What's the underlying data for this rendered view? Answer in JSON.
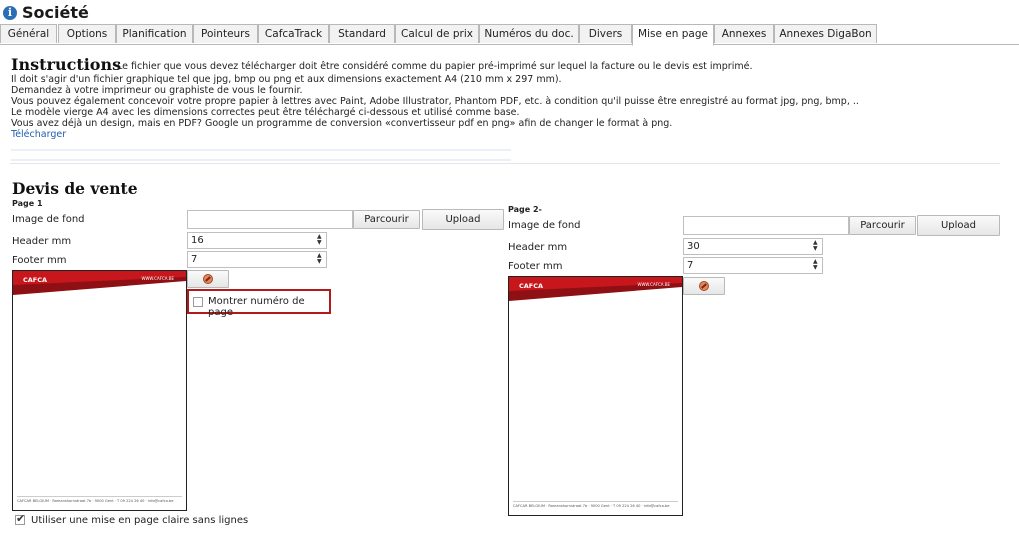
{
  "header": {
    "title": "Société",
    "info_icon": "i"
  },
  "tabs": [
    {
      "label": "Général",
      "active": false
    },
    {
      "label": "Options",
      "active": false
    },
    {
      "label": "Planification",
      "active": false
    },
    {
      "label": "Pointeurs",
      "active": false
    },
    {
      "label": "CafcaTrack",
      "active": false
    },
    {
      "label": "Standard",
      "active": false
    },
    {
      "label": "Calcul de prix",
      "active": false
    },
    {
      "label": "Numéros du doc.",
      "active": false
    },
    {
      "label": "Divers",
      "active": false
    },
    {
      "label": "Mise en page",
      "active": true
    },
    {
      "label": "Annexes",
      "active": false
    },
    {
      "label": "Annexes DigaBon",
      "active": false
    }
  ],
  "instructions": {
    "title": "Instructions",
    "lead": "Le fichier que vous devez télécharger doit être considéré comme du papier pré-imprimé sur lequel la facture ou le devis est imprimé.",
    "lines": [
      "Il doit s'agir d'un fichier graphique tel que jpg, bmp ou png et aux dimensions exactement A4 (210 mm x 297 mm).",
      "Demandez à votre imprimeur ou graphiste de vous le fournir.",
      "Vous pouvez également concevoir votre propre papier à lettres avec Paint, Adobe Illustrator, Phantom PDF, etc. à condition qu'il puisse être enregistré au format jpg, png, bmp, ..",
      "Le modèle vierge A4 avec les dimensions correctes peut être téléchargé ci-dessous et utilisé comme base.",
      "Vous avez déjà un design, mais en PDF? Google un programme de conversion «convertisseur pdf en png» afin de changer le format à png."
    ],
    "download_link": "Télécharger"
  },
  "section": {
    "title": "Devis de vente"
  },
  "page1": {
    "heading": "Page 1",
    "background_label": "Image de fond",
    "background_value": "",
    "browse_label": "Parcourir",
    "upload_label": "Upload",
    "header_label": "Header mm",
    "header_value": "16",
    "footer_label": "Footer mm",
    "footer_value": "7",
    "show_page_number_label": "Montrer numéro de page",
    "show_page_number_checked": false
  },
  "page2": {
    "heading": "Page 2-",
    "background_label": "Image de fond",
    "background_value": "",
    "browse_label": "Parcourir",
    "upload_label": "Upload",
    "header_label": "Header mm",
    "header_value": "30",
    "footer_label": "Footer mm",
    "footer_value": "7"
  },
  "letterhead": {
    "logo_text": "CAFCA",
    "url_text": "WWW.CAFCA.BE",
    "footer_text": "CAFCAR BELGIUM  ·  Romanshornstraat 7b  ·  9000 Gent  ·  T 09 224 26 40  ·  info@cafca.be",
    "band_color": "#c8161d",
    "band_dark_color": "#8e0f14"
  },
  "light_layout": {
    "label": "Utiliser une mise en page claire sans lignes",
    "checked": true
  },
  "colors": {
    "accent": "#2a6fb5",
    "highlight_border": "#b21a1a",
    "link": "#1f5fb0"
  },
  "icons": {
    "header": "info-icon",
    "reset": "no-entry-icon",
    "checked": "checkmark-icon"
  }
}
